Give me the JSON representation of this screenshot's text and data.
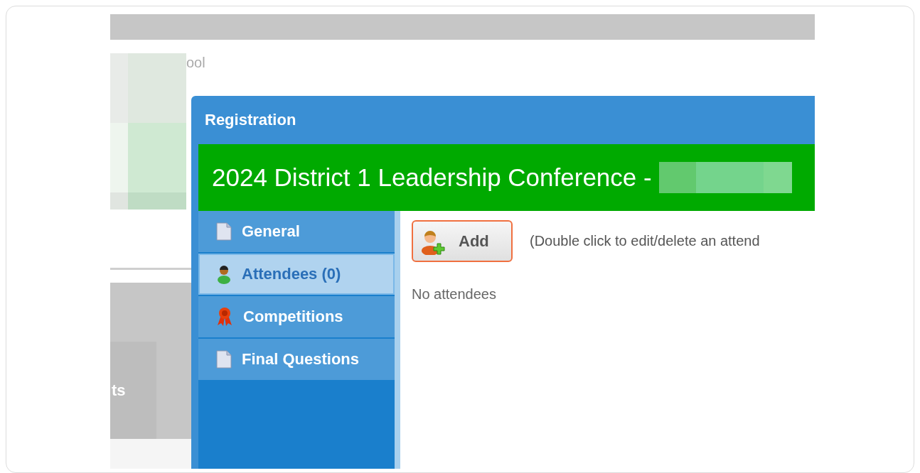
{
  "background": {
    "partial_label": "ool",
    "partial_heading": "ts"
  },
  "dialog": {
    "title": "Registration",
    "event_title": "2024 District 1 Leadership Conference -",
    "nav": [
      {
        "label": "General",
        "kind": "page",
        "selected": false
      },
      {
        "label": "Attendees (0)",
        "kind": "person",
        "selected": true
      },
      {
        "label": "Competitions",
        "kind": "ribbon",
        "selected": false
      },
      {
        "label": "Final Questions",
        "kind": "page",
        "selected": false
      }
    ],
    "add_button": "Add",
    "hint": "(Double click to edit/delete an attend",
    "empty_message": "No attendees"
  }
}
